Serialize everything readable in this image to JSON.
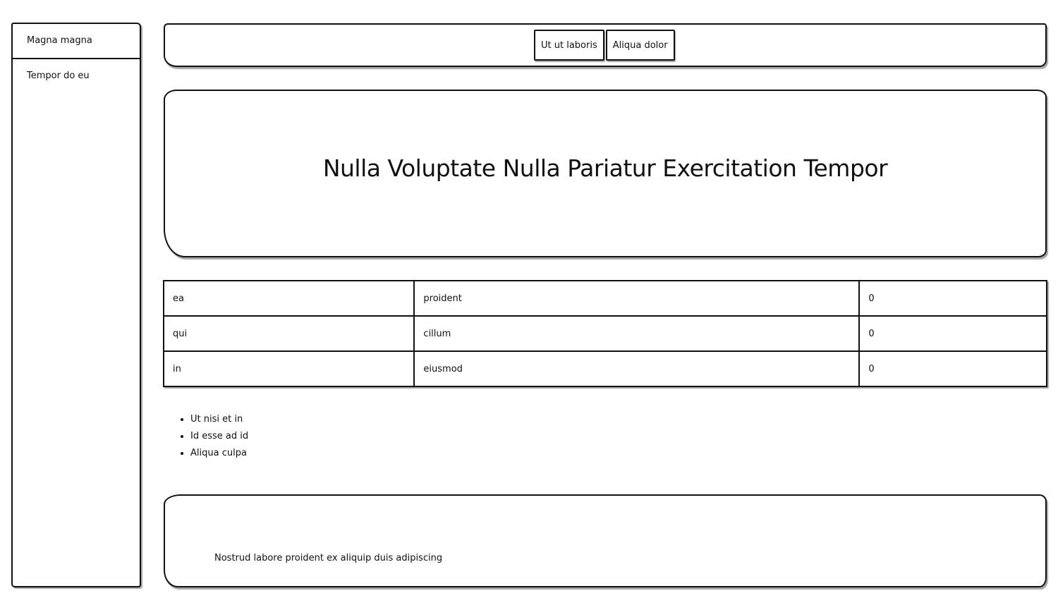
{
  "sidebar": {
    "items": [
      {
        "label": "Magna magna"
      },
      {
        "label": "Tempor do eu"
      }
    ]
  },
  "header": {
    "buttons": [
      {
        "label": "Ut ut laboris"
      },
      {
        "label": "Aliqua dolor"
      }
    ]
  },
  "hero": {
    "title": "Nulla Voluptate Nulla Pariatur Exercitation Tempor"
  },
  "table": {
    "rows": [
      {
        "c1": "ea",
        "c2": "proident",
        "c3": "0"
      },
      {
        "c1": "qui",
        "c2": "cillum",
        "c3": "0"
      },
      {
        "c1": "in",
        "c2": "eiusmod",
        "c3": "0"
      }
    ]
  },
  "list": {
    "items": [
      "Ut nisi et in",
      "Id esse ad id",
      "Aliqua culpa"
    ]
  },
  "footer": {
    "text": "Nostrud labore proident ex aliquip duis adipiscing"
  }
}
